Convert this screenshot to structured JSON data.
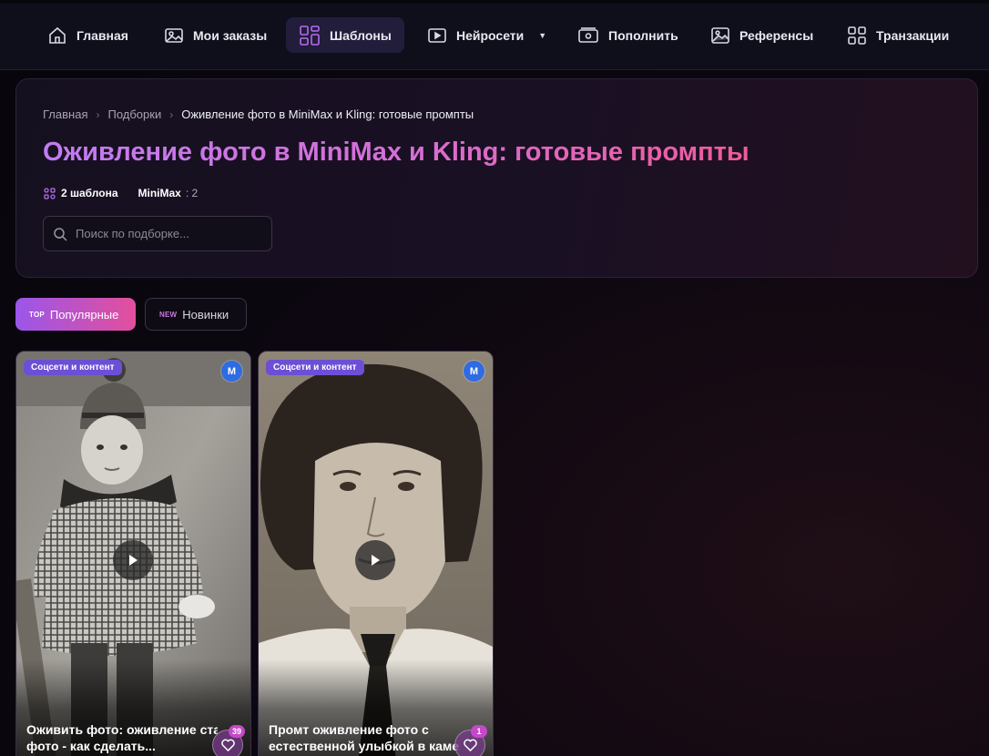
{
  "nav": {
    "items": [
      {
        "label": "Главная",
        "icon": "home-icon"
      },
      {
        "label": "Мои заказы",
        "icon": "image-icon"
      },
      {
        "label": "Шаблоны",
        "icon": "grid-icon",
        "active": true
      },
      {
        "label": "Нейросети",
        "icon": "video-play-icon",
        "dropdown": true
      },
      {
        "label": "Пополнить",
        "icon": "wallet-icon"
      },
      {
        "label": "Референсы",
        "icon": "picture-icon"
      },
      {
        "label": "Транзакции",
        "icon": "grid-squares-icon"
      }
    ]
  },
  "breadcrumb": {
    "items": [
      "Главная",
      "Подборки",
      "Оживление фото в MiniMax и Kling: готовые промпты"
    ],
    "separator": "›"
  },
  "hero": {
    "title": "Оживление фото в MiniMax и Kling: готовые промпты",
    "templates_count": "2 шаблона",
    "model_name": "MiniMax",
    "model_count": ": 2"
  },
  "search": {
    "placeholder": "Поиск по подборке..."
  },
  "tabs": {
    "popular": {
      "tag": "TOP",
      "label": "Популярные",
      "active": true
    },
    "new": {
      "tag": "NEW",
      "label": "Новинки"
    }
  },
  "cards": [
    {
      "category": "Соцсети и контент",
      "model_letter": "M",
      "title_line1": "Оживить фото: оживление стар",
      "title_line2": "фото - как сделать...",
      "likes": "39"
    },
    {
      "category": "Соцсети и контент",
      "model_letter": "M",
      "title_line1": "Промт оживление фото с",
      "title_line2": "естественной улыбкой в камер",
      "likes": "1"
    }
  ],
  "colors": {
    "accent_gradient_start": "#9a56ea",
    "accent_gradient_end": "#e34f9c",
    "model_badge": "#2f6be3",
    "category_badge": "#6c4fd6"
  }
}
